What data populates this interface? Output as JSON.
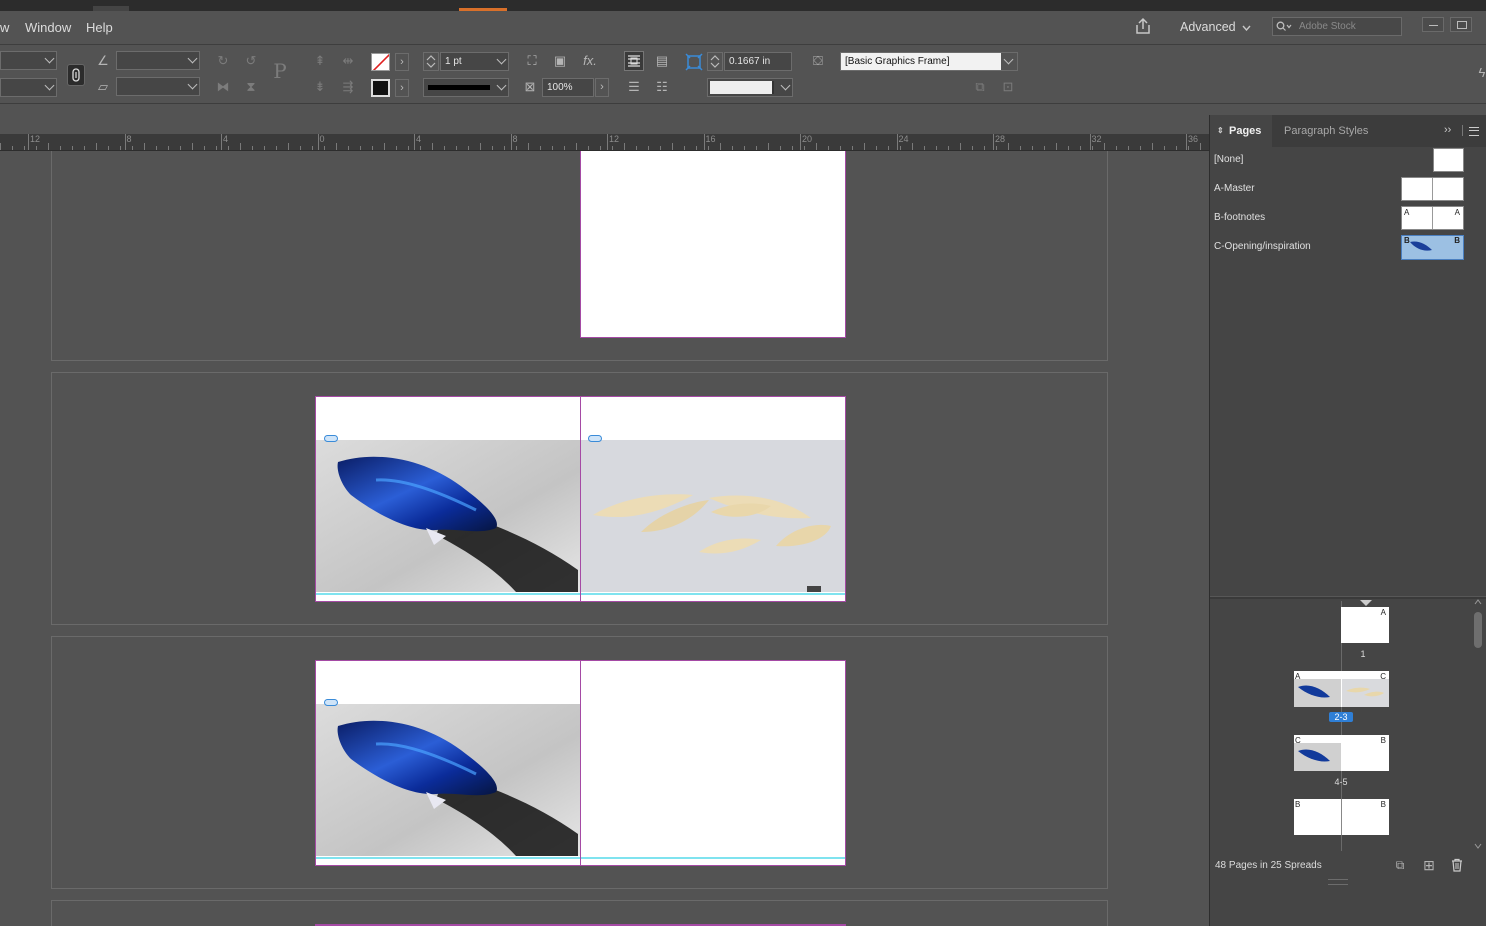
{
  "menubar": {
    "items": [
      "w",
      "Window",
      "Help"
    ],
    "workspace_label": "Advanced",
    "stock_placeholder": "Adobe Stock"
  },
  "control": {
    "stroke_weight": "1 pt",
    "scale_percent": "100%",
    "offset_value": "0.1667 in",
    "object_style": "[Basic Graphics Frame]",
    "fx_label": "fx."
  },
  "ruler": {
    "ticks": [
      "12",
      "8",
      "4",
      "0",
      "4",
      "8",
      "12",
      "16",
      "20",
      "24",
      "28",
      "32",
      "36"
    ]
  },
  "pages_panel": {
    "tabs": [
      "Pages",
      "Paragraph Styles"
    ],
    "masters": [
      "[None]",
      "A-Master",
      "B-footnotes",
      "C-Opening/inspiration"
    ],
    "thumbnails": [
      {
        "label": "1",
        "prefixes": [
          "A"
        ]
      },
      {
        "label": "2-3",
        "prefixes": [
          "A",
          "C"
        ]
      },
      {
        "label": "4-5",
        "prefixes": [
          "C",
          "B"
        ]
      },
      {
        "label": "",
        "prefixes": [
          "B",
          "B"
        ]
      }
    ],
    "master_prefixes": {
      "b_footnotes": [
        "A",
        "A"
      ],
      "c_opening": [
        "B",
        "B"
      ]
    },
    "status": "48 Pages in 25 Spreads"
  },
  "colors": {
    "ui_bg": "#535353",
    "panel_bg": "#454545",
    "page_border": "#a54aa5",
    "selection_blue": "#2f7fd6",
    "column_guide": "#7fe3ef"
  }
}
